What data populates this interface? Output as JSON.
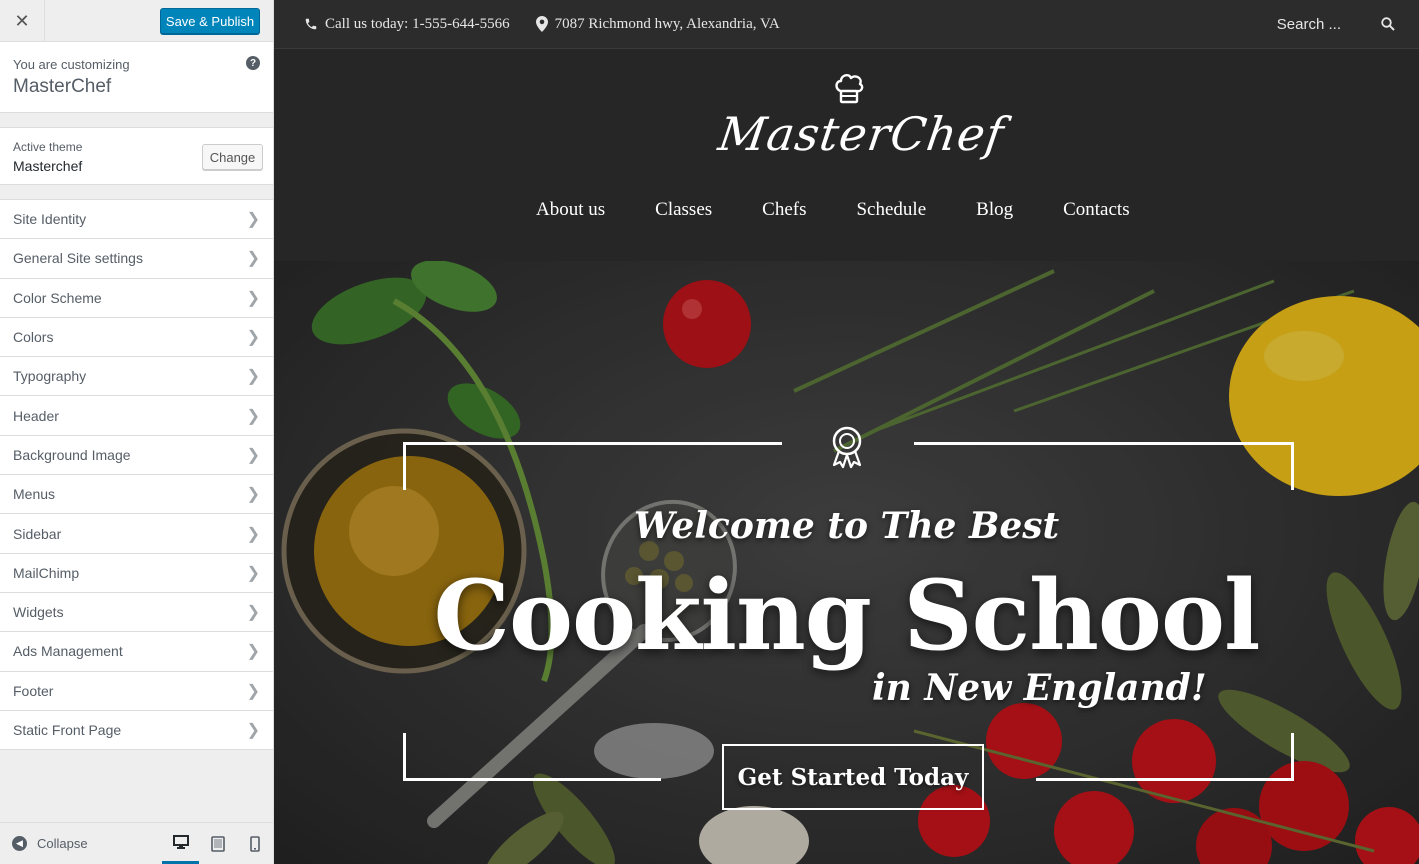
{
  "customizer": {
    "close_label": "✕",
    "publish_label": "Save & Publish",
    "info_small": "You are customizing",
    "info_site": "MasterChef",
    "help_label": "?",
    "theme_small": "Active theme",
    "theme_name": "Masterchef",
    "change_label": "Change",
    "sections": [
      {
        "label": "Site Identity"
      },
      {
        "label": "General Site settings"
      },
      {
        "label": "Color Scheme"
      },
      {
        "label": "Colors"
      },
      {
        "label": "Typography"
      },
      {
        "label": "Header"
      },
      {
        "label": "Background Image"
      },
      {
        "label": "Menus"
      },
      {
        "label": "Sidebar"
      },
      {
        "label": "MailChimp"
      },
      {
        "label": "Widgets"
      },
      {
        "label": "Ads Management"
      },
      {
        "label": "Footer"
      },
      {
        "label": "Static Front Page"
      }
    ],
    "collapse_label": "Collapse",
    "active_device": "desktop"
  },
  "site": {
    "phone": "Call us today: 1-555-644-5566",
    "address": "7087 Richmond hwy, Alexandria, VA",
    "search_placeholder": "Search ...",
    "logo_text": "MasterChef",
    "nav": [
      "About us",
      "Classes",
      "Chefs",
      "Schedule",
      "Blog",
      "Contacts"
    ],
    "hero": {
      "subtitle": "Welcome to The Best",
      "title": "Cooking School",
      "tail": "in New England!",
      "cta": "Get Started Today"
    }
  },
  "colors": {
    "publish": "#0085ba",
    "header_bg": "#262626",
    "topbar_bg": "#2c2c2c"
  }
}
